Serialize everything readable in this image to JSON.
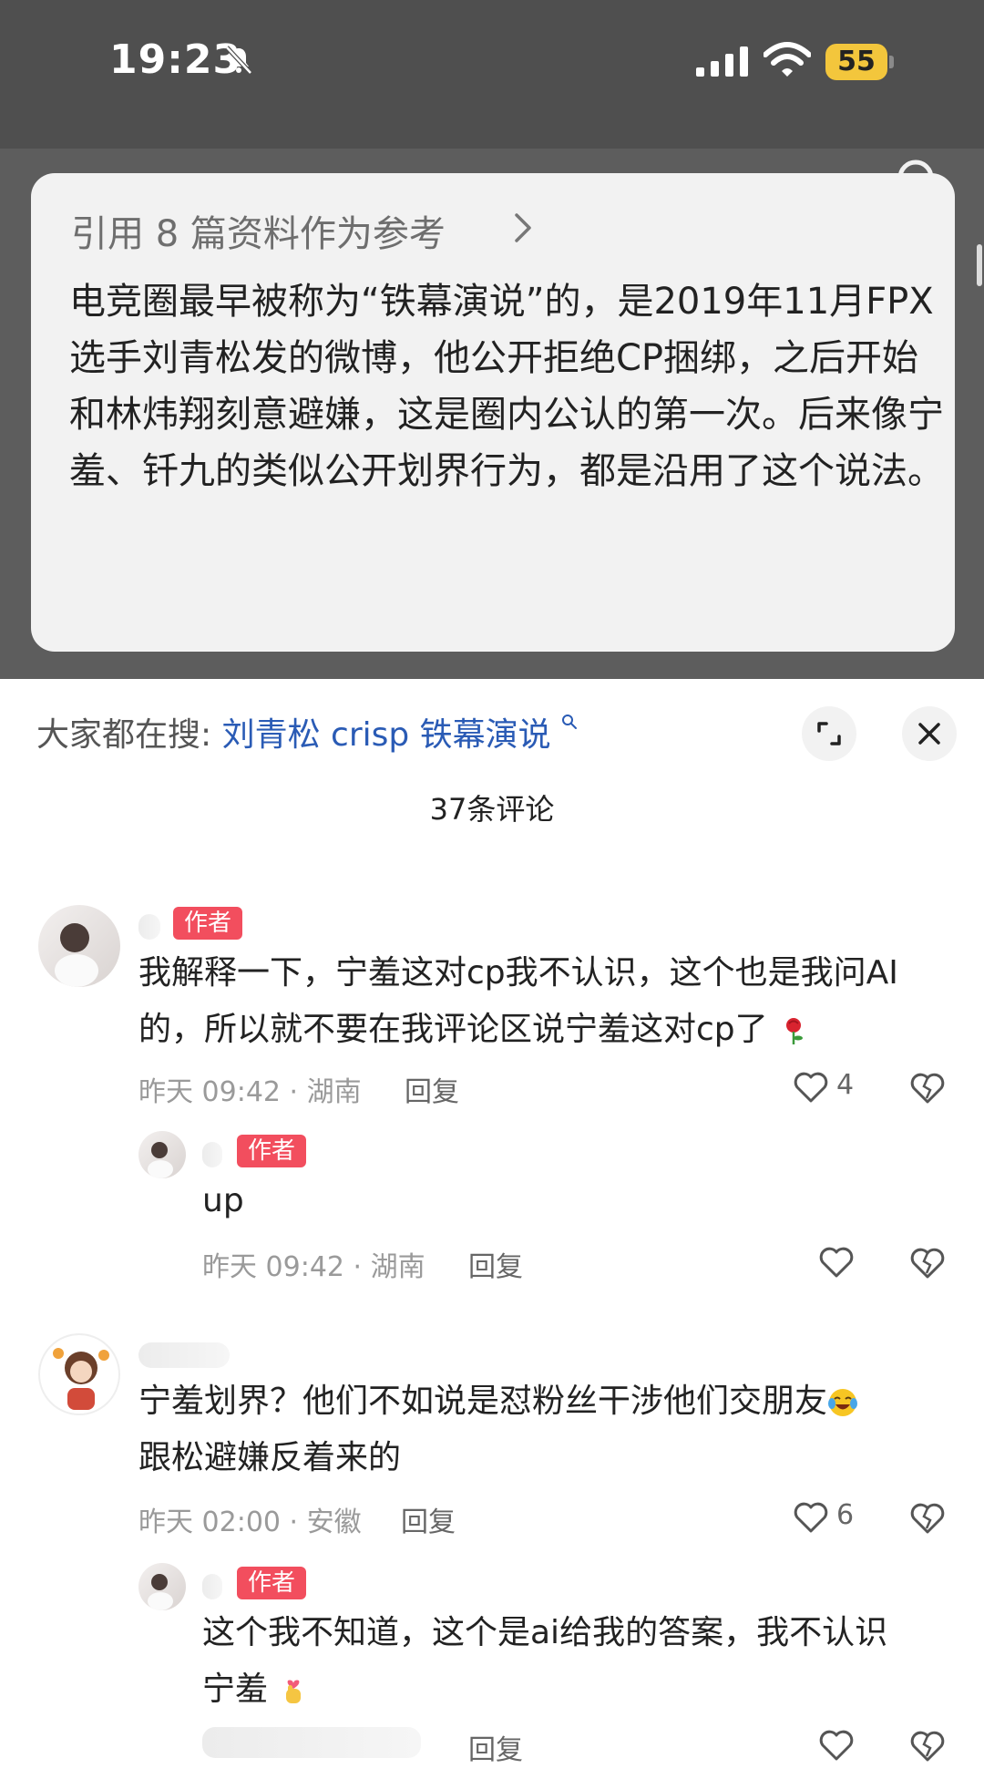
{
  "status_bar": {
    "time": "19:23",
    "battery": "55"
  },
  "reference": {
    "header": "引用 8 篇资料作为参考",
    "body": "电竞圈最早被称为“铁幕演说”的，是2019年11月FPX选手刘青松发的微博，他公开拒绝CP捆绑，之后开始和林炜翔刻意避嫌，这是圈内公认的第一次。后来像宁羞、钎九的类似公开划界行为，都是沿用了这个说法。"
  },
  "sheet": {
    "search_prefix": "大家都在搜:",
    "search_keyword": "刘青松 crisp 铁幕演说",
    "comment_count": "37条评论"
  },
  "comments": [
    {
      "badge": "作者",
      "text": "我解释一下，宁羞这对cp我不认识，这个也是我问AI的，所以就不要在我评论区说宁羞这对cp了",
      "emoji": "rose-emoji",
      "meta": "昨天 09:42 · 湖南",
      "reply": "回复",
      "likes": "4"
    },
    {
      "badge": "作者",
      "text": "up",
      "meta": "昨天 09:42 · 湖南",
      "reply": "回复"
    },
    {
      "text_line1": "宁羞划界？他们不如说是怼粉丝干涉他们交朋友",
      "text_line2": "跟松避嫌反着来的",
      "emoji": "crying-laughing-emoji",
      "meta": "昨天 02:00 · 安徽",
      "reply": "回复",
      "likes": "6"
    },
    {
      "badge": "作者",
      "text_line1": "这个我不知道，这个是ai给我的答案，我不认识",
      "text_line2": "宁羞",
      "emoji": "finger-heart-emoji",
      "reply": "回复"
    }
  ],
  "colors": {
    "badge": "#f24e5e",
    "keyword": "#2a5bb5",
    "battery": "#f3c63c"
  }
}
